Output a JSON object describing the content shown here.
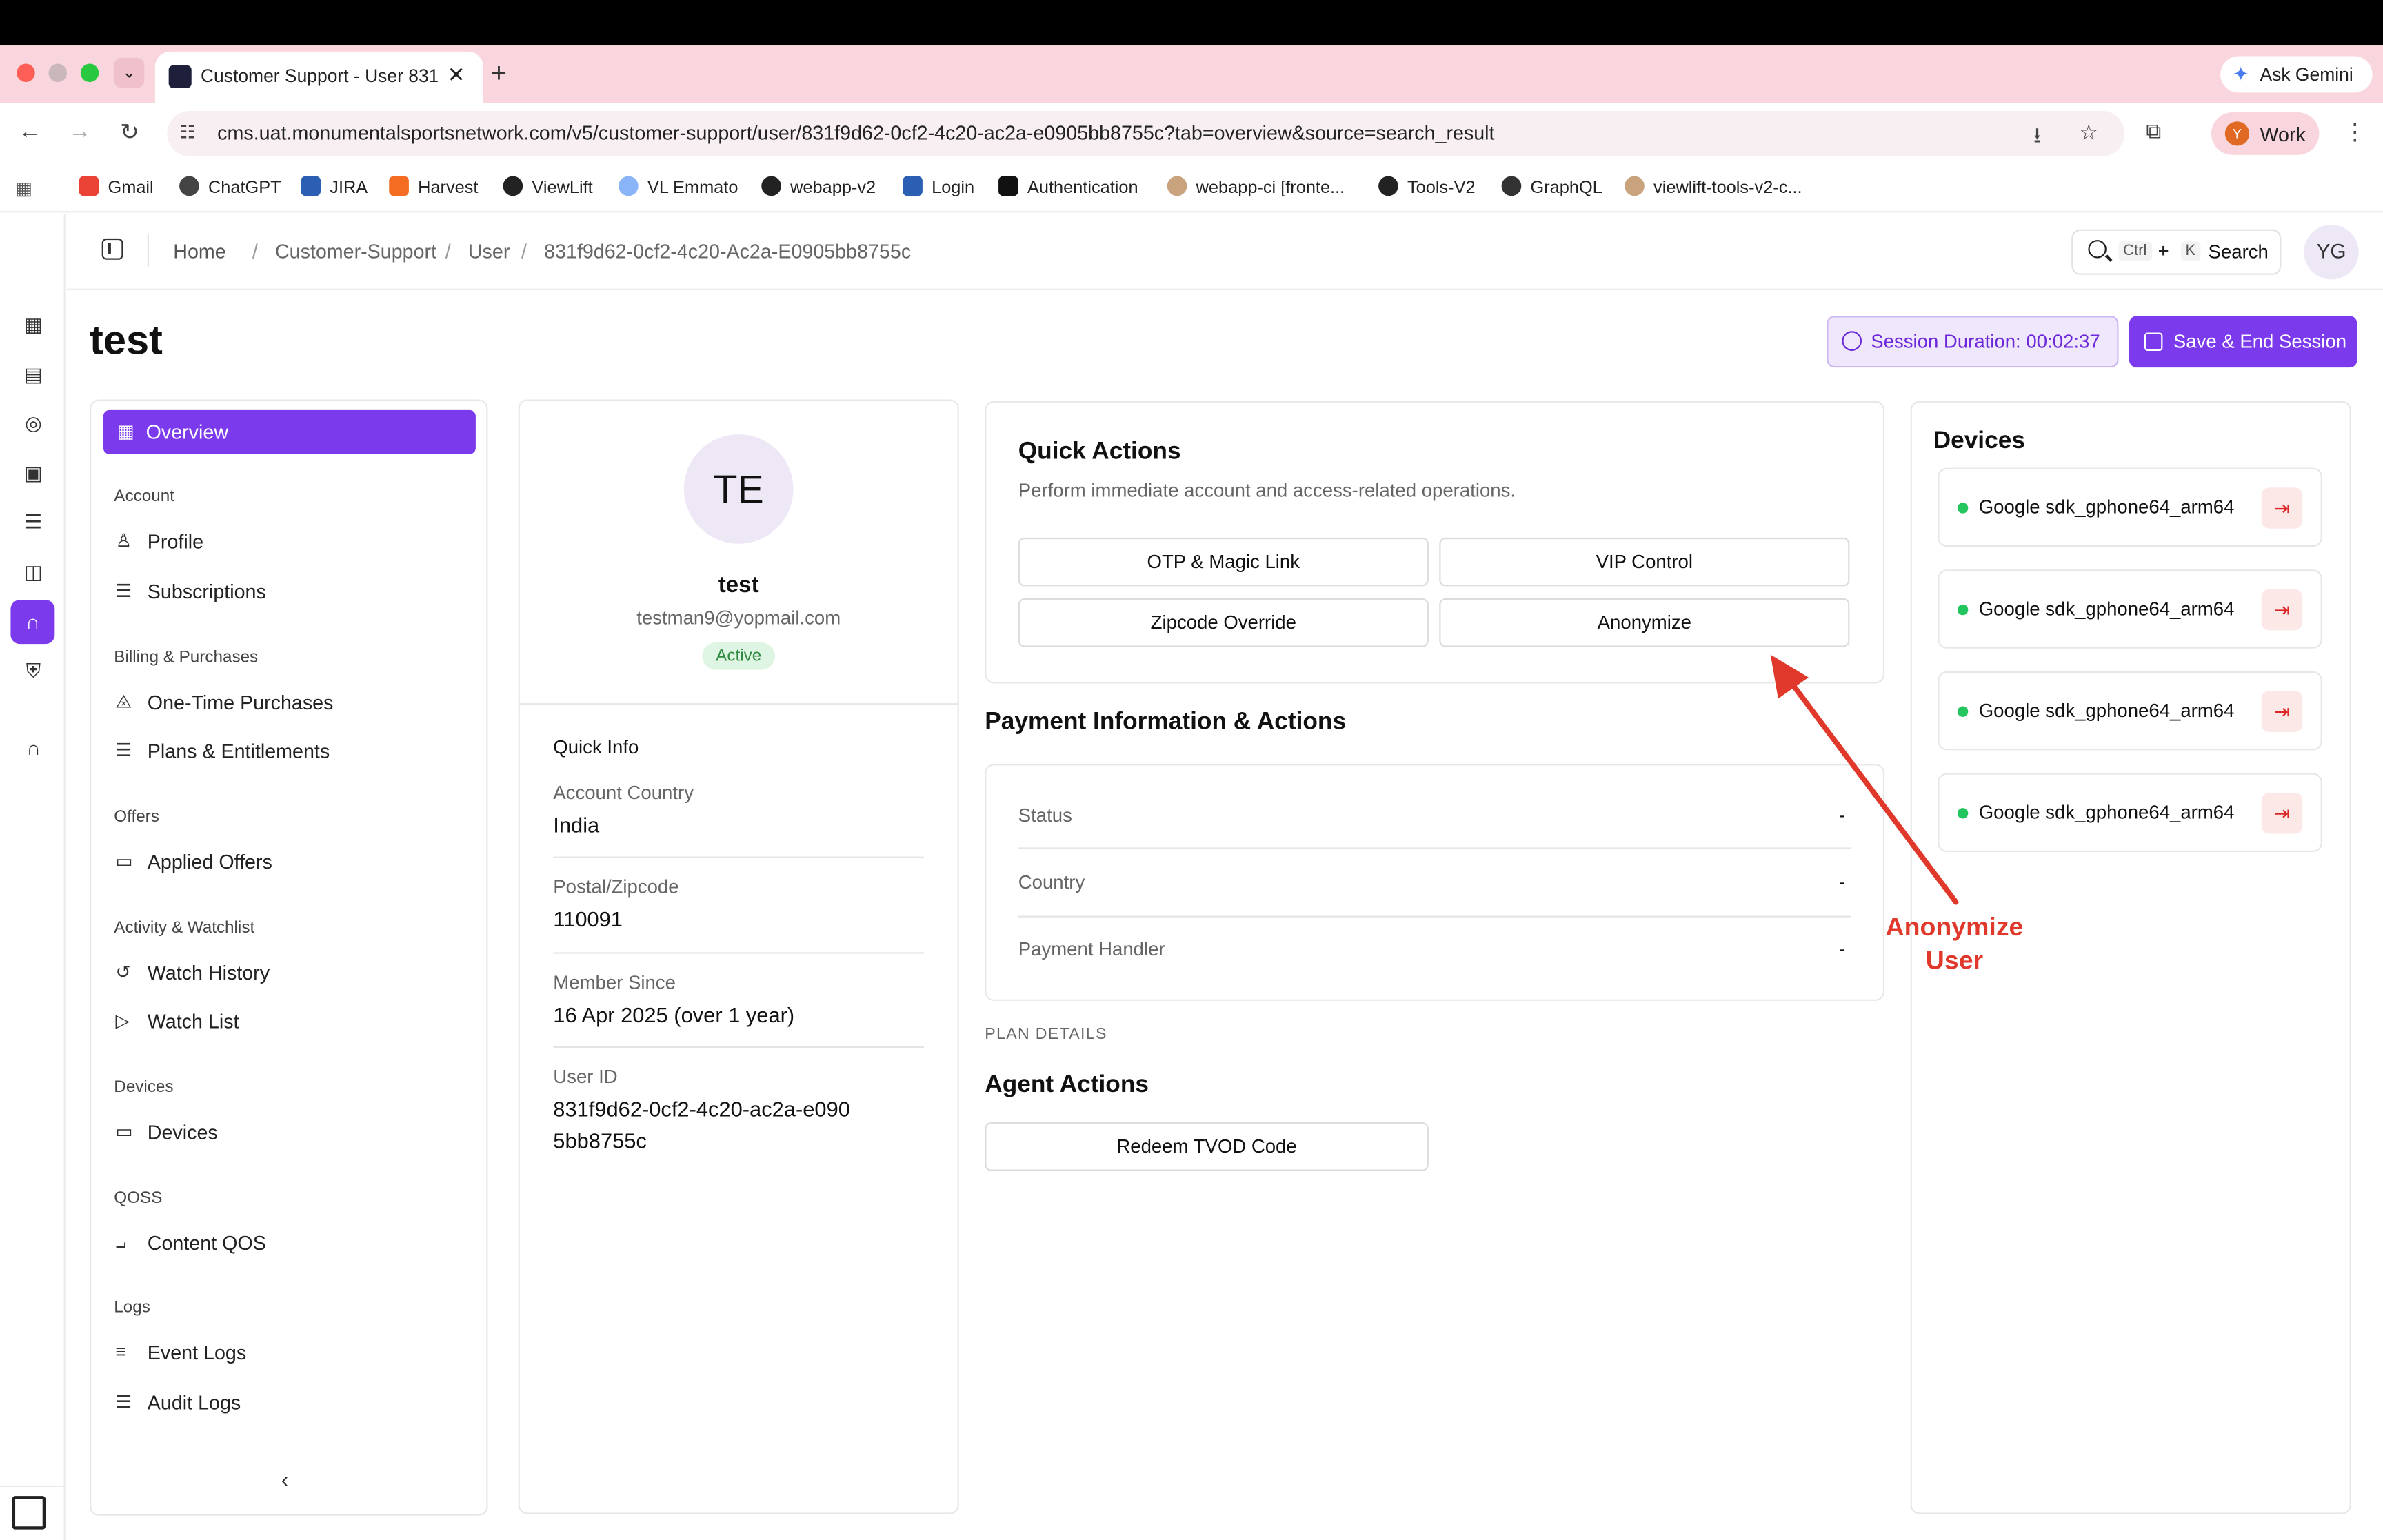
{
  "browser": {
    "tab_title": "Customer Support - User 831",
    "url": "cms.uat.monumentalsportsnetwork.com/v5/customer-support/user/831f9d62-0cf2-4c20-ac2a-e0905bb8755c?tab=overview&source=search_result",
    "ask_gemini": "Ask Gemini",
    "profile_initial": "Y",
    "profile_label": "Work",
    "bookmarks": [
      "Gmail",
      "ChatGPT",
      "JIRA",
      "Harvest",
      "ViewLift",
      "VL Emmato",
      "webapp-v2",
      "Login",
      "Authentication",
      "webapp-ci [fronte...",
      "Tools-V2",
      "GraphQL",
      "viewlift-tools-v2-c..."
    ]
  },
  "header": {
    "breadcrumb": [
      "Home",
      "Customer-Support",
      "User",
      "831f9d62-0cf2-4c20-Ac2a-E0905bb8755c"
    ],
    "search": {
      "key1": "Ctrl",
      "plus": "+",
      "key2": "K",
      "label": "Search"
    },
    "user_initials": "YG"
  },
  "page": {
    "title": "test",
    "session_label": "Session Duration:",
    "session_time": "00:02:37",
    "save_label": "Save & End Session"
  },
  "nav": {
    "overview": "Overview",
    "sections": [
      {
        "title": "Account",
        "items": [
          "Profile",
          "Subscriptions"
        ]
      },
      {
        "title": "Billing & Purchases",
        "items": [
          "One-Time Purchases",
          "Plans & Entitlements"
        ]
      },
      {
        "title": "Offers",
        "items": [
          "Applied Offers"
        ]
      },
      {
        "title": "Activity & Watchlist",
        "items": [
          "Watch History",
          "Watch List"
        ]
      },
      {
        "title": "Devices",
        "items": [
          "Devices"
        ]
      },
      {
        "title": "QOSS",
        "items": [
          "Content QOS"
        ]
      },
      {
        "title": "Logs",
        "items": [
          "Event Logs",
          "Audit Logs"
        ]
      }
    ]
  },
  "profile": {
    "initials": "TE",
    "name": "test",
    "email": "testman9@yopmail.com",
    "status": "Active",
    "quick_info_title": "Quick Info",
    "fields": [
      {
        "label": "Account Country",
        "value": "India"
      },
      {
        "label": "Postal/Zipcode",
        "value": "110091"
      },
      {
        "label": "Member Since",
        "value": "16 Apr 2025 (over 1 year)"
      },
      {
        "label": "User ID",
        "value": "831f9d62-0cf2-4c20-ac2a-e0905bb8755c"
      }
    ]
  },
  "quick_actions": {
    "title": "Quick Actions",
    "subtitle": "Perform immediate account and access-related operations.",
    "buttons": [
      "OTP & Magic Link",
      "VIP Control",
      "Zipcode Override",
      "Anonymize"
    ]
  },
  "payment": {
    "title": "Payment Information & Actions",
    "rows": [
      {
        "label": "Status",
        "value": "-"
      },
      {
        "label": "Country",
        "value": "-"
      },
      {
        "label": "Payment Handler",
        "value": "-"
      }
    ]
  },
  "plan_details": "PLAN DETAILS",
  "agent_actions": {
    "title": "Agent Actions",
    "redeem": "Redeem TVOD Code"
  },
  "devices": {
    "title": "Devices",
    "items": [
      "Google sdk_gphone64_arm64",
      "Google sdk_gphone64_arm64",
      "Google sdk_gphone64_arm64",
      "Google sdk_gphone64_arm64"
    ]
  },
  "annotation": {
    "line1": "Anonymize",
    "line2": "User",
    "color": "#e0392b"
  },
  "colors": {
    "accent": "#7c3aed",
    "active_green": "#22c55e",
    "logout_red": "#dc2626"
  }
}
